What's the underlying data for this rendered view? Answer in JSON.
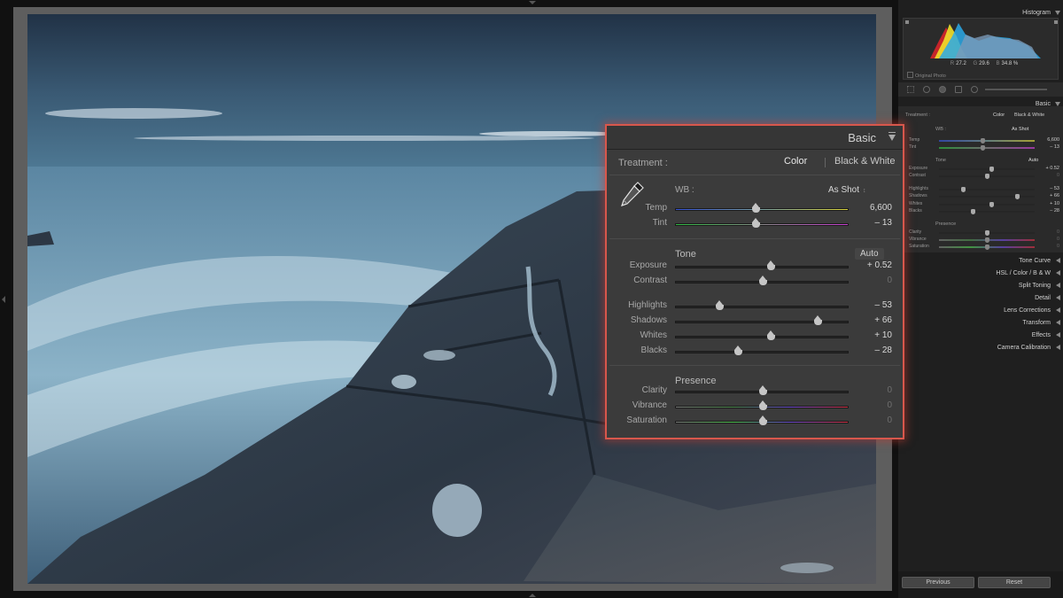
{
  "panels": {
    "histogram_title": "Histogram",
    "histogram_readout": {
      "r_label": "R",
      "r_value": "27.2",
      "g_label": "G",
      "g_value": "29.6",
      "b_label": "B",
      "b_value": "34.8 %"
    },
    "original_photo_label": "Original Photo",
    "basic_title": "Basic",
    "collapsed_sections": [
      "Tone Curve",
      "HSL / Color / B & W",
      "Split Toning",
      "Detail",
      "Lens Corrections",
      "Transform",
      "Effects",
      "Camera Calibration"
    ],
    "previous_button": "Previous",
    "reset_button": "Reset"
  },
  "basic": {
    "title": "Basic",
    "treatment_label": "Treatment :",
    "treatment_color": "Color",
    "treatment_bw": "Black & White",
    "wb_label": "WB :",
    "wb_value": "As Shot",
    "tone_heading": "Tone",
    "auto_button": "Auto",
    "presence_heading": "Presence",
    "sliders": [
      {
        "key": "temp",
        "label": "Temp",
        "value": "6,600",
        "position": 0.46,
        "track": "temp"
      },
      {
        "key": "tint",
        "label": "Tint",
        "value": "– 13",
        "position": 0.46,
        "track": "tint"
      },
      {
        "key": "exposure",
        "label": "Exposure",
        "value": "+ 0.52",
        "position": 0.55,
        "track": "plain"
      },
      {
        "key": "contrast",
        "label": "Contrast",
        "value": "0",
        "position": 0.5,
        "track": "plain"
      },
      {
        "key": "highlights",
        "label": "Highlights",
        "value": "– 53",
        "position": 0.25,
        "track": "plain"
      },
      {
        "key": "shadows",
        "label": "Shadows",
        "value": "+ 66",
        "position": 0.82,
        "track": "plain"
      },
      {
        "key": "whites",
        "label": "Whites",
        "value": "+ 10",
        "position": 0.55,
        "track": "plain"
      },
      {
        "key": "blacks",
        "label": "Blacks",
        "value": "– 28",
        "position": 0.36,
        "track": "plain"
      },
      {
        "key": "clarity",
        "label": "Clarity",
        "value": "0",
        "position": 0.5,
        "track": "plain"
      },
      {
        "key": "vibrance",
        "label": "Vibrance",
        "value": "0",
        "position": 0.5,
        "track": "vibrance"
      },
      {
        "key": "saturation",
        "label": "Saturation",
        "value": "0",
        "position": 0.5,
        "track": "saturation"
      }
    ]
  },
  "colors": {
    "highlight_border": "#d8574c",
    "panel_bg": "#3b3b3b"
  },
  "icons": [
    "eyedropper-icon",
    "panel-collapse-icon",
    "crop-tool-icon",
    "spot-removal-icon",
    "red-eye-icon",
    "graduated-filter-icon",
    "radial-filter-icon",
    "adjustment-brush-icon"
  ]
}
